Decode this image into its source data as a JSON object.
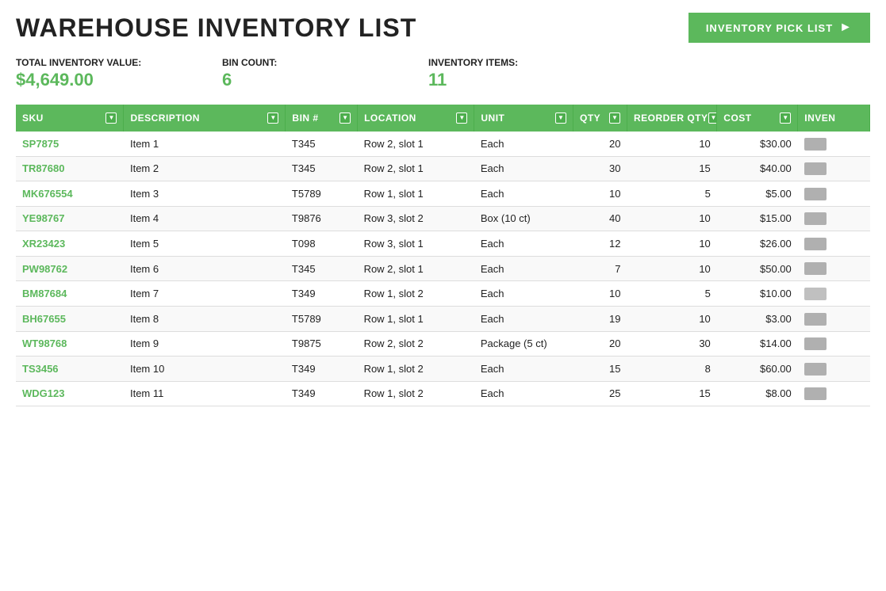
{
  "header": {
    "title": "WAREHOUSE INVENTORY LIST",
    "pick_list_button": "INVENTORY  PICK LIST"
  },
  "stats": {
    "total_inventory_label": "TOTAL INVENTORY VALUE:",
    "total_inventory_value": "$4,649.00",
    "bin_count_label": "BIN COUNT:",
    "bin_count_value": "6",
    "inventory_items_label": "INVENTORY ITEMS:",
    "inventory_items_value": "11"
  },
  "table": {
    "columns": [
      {
        "key": "sku",
        "label": "SKU",
        "filter": true
      },
      {
        "key": "desc",
        "label": "DESCRIPTION",
        "filter": true
      },
      {
        "key": "bin",
        "label": "BIN #",
        "filter": true
      },
      {
        "key": "location",
        "label": "LOCATION",
        "filter": true
      },
      {
        "key": "unit",
        "label": "UNIT",
        "filter": true
      },
      {
        "key": "qty",
        "label": "QTY",
        "filter": true
      },
      {
        "key": "reorder",
        "label": "REORDER QTY",
        "filter": true
      },
      {
        "key": "cost",
        "label": "COST",
        "filter": true
      },
      {
        "key": "inven",
        "label": "INVEN",
        "filter": false
      }
    ],
    "rows": [
      {
        "sku": "SP7875",
        "desc": "Item 1",
        "bin": "T345",
        "location": "Row 2, slot 1",
        "unit": "Each",
        "qty": "20",
        "reorder": "10",
        "cost": "$30.00",
        "swatch": "#b0b0b0"
      },
      {
        "sku": "TR87680",
        "desc": "Item 2",
        "bin": "T345",
        "location": "Row 2, slot 1",
        "unit": "Each",
        "qty": "30",
        "reorder": "15",
        "cost": "$40.00",
        "swatch": "#b0b0b0"
      },
      {
        "sku": "MK676554",
        "desc": "Item 3",
        "bin": "T5789",
        "location": "Row 1, slot 1",
        "unit": "Each",
        "qty": "10",
        "reorder": "5",
        "cost": "$5.00",
        "swatch": "#b0b0b0"
      },
      {
        "sku": "YE98767",
        "desc": "Item 4",
        "bin": "T9876",
        "location": "Row 3, slot 2",
        "unit": "Box (10 ct)",
        "qty": "40",
        "reorder": "10",
        "cost": "$15.00",
        "swatch": "#b0b0b0"
      },
      {
        "sku": "XR23423",
        "desc": "Item 5",
        "bin": "T098",
        "location": "Row 3, slot 1",
        "unit": "Each",
        "qty": "12",
        "reorder": "10",
        "cost": "$26.00",
        "swatch": "#b0b0b0"
      },
      {
        "sku": "PW98762",
        "desc": "Item 6",
        "bin": "T345",
        "location": "Row 2, slot 1",
        "unit": "Each",
        "qty": "7",
        "reorder": "10",
        "cost": "$50.00",
        "swatch": "#b0b0b0"
      },
      {
        "sku": "BM87684",
        "desc": "Item 7",
        "bin": "T349",
        "location": "Row 1, slot 2",
        "unit": "Each",
        "qty": "10",
        "reorder": "5",
        "cost": "$10.00",
        "swatch": "#c0c0c0"
      },
      {
        "sku": "BH67655",
        "desc": "Item 8",
        "bin": "T5789",
        "location": "Row 1, slot 1",
        "unit": "Each",
        "qty": "19",
        "reorder": "10",
        "cost": "$3.00",
        "swatch": "#b0b0b0"
      },
      {
        "sku": "WT98768",
        "desc": "Item 9",
        "bin": "T9875",
        "location": "Row 2, slot 2",
        "unit": "Package (5 ct)",
        "qty": "20",
        "reorder": "30",
        "cost": "$14.00",
        "swatch": "#b0b0b0"
      },
      {
        "sku": "TS3456",
        "desc": "Item 10",
        "bin": "T349",
        "location": "Row 1, slot 2",
        "unit": "Each",
        "qty": "15",
        "reorder": "8",
        "cost": "$60.00",
        "swatch": "#b0b0b0"
      },
      {
        "sku": "WDG123",
        "desc": "Item 11",
        "bin": "T349",
        "location": "Row 1, slot 2",
        "unit": "Each",
        "qty": "25",
        "reorder": "15",
        "cost": "$8.00",
        "swatch": "#b0b0b0"
      }
    ]
  }
}
